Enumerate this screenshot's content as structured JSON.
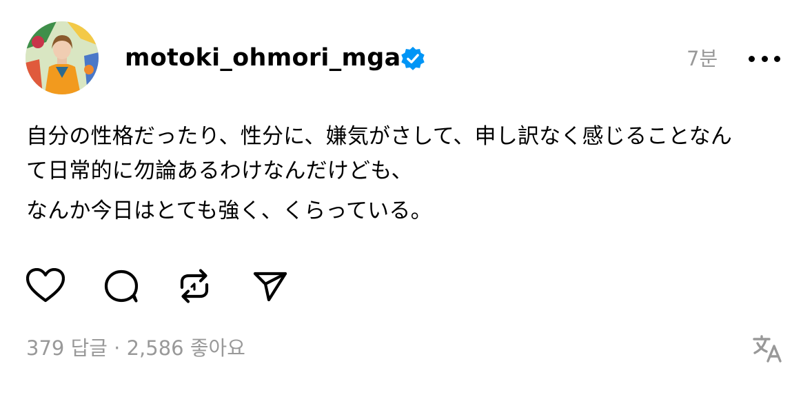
{
  "post": {
    "username": "motoki_ohmori_mga",
    "time_ago": "7분",
    "body": {
      "paragraph1_line1": "自分の性格だったり、性分に、嫌気がさして、申し訳なく感じることなん",
      "paragraph1_line2": "て日常的に勿論あるわけなんだけども、",
      "paragraph2": "なんか今日はとても強く、くらっている。"
    },
    "stats": {
      "replies": "379 답글",
      "separator": " · ",
      "likes": "2,586 좋아요"
    }
  },
  "icons": {
    "verified": "verified-badge-icon",
    "more": "more-icon",
    "like": "heart-icon",
    "reply": "comment-icon",
    "repost": "repost-icon",
    "share": "send-icon",
    "translate": "translate-icon"
  },
  "colors": {
    "verified_blue": "#0095f6",
    "muted_text": "#999999",
    "text": "#000000"
  }
}
